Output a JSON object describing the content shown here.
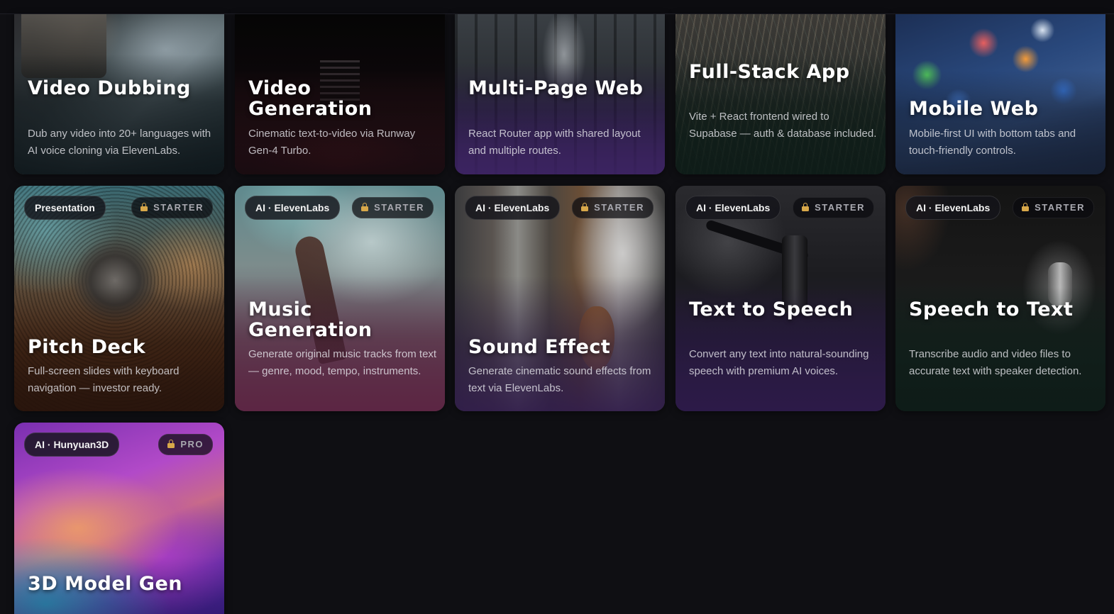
{
  "cards": [
    {
      "title": "Video Dubbing",
      "desc": "Dub any video into 20+ languages with AI voice cloning via ElevenLabs."
    },
    {
      "title": "Video Generation",
      "desc": "Cinematic text-to-video via Runway Gen-4 Turbo."
    },
    {
      "title": "Multi-Page Web",
      "desc": "React Router app with shared layout and multiple routes."
    },
    {
      "title": "Full-Stack App",
      "desc": "Vite + React frontend wired to Supabase — auth & database included."
    },
    {
      "title": "Mobile Web",
      "desc": "Mobile-first UI with bottom tabs and touch-friendly controls."
    },
    {
      "tag": "Presentation",
      "badge": "STARTER",
      "title": "Pitch Deck",
      "desc": "Full-screen slides with keyboard navigation — investor ready."
    },
    {
      "tag": "AI · ElevenLabs",
      "badge": "STARTER",
      "title": "Music Generation",
      "desc": "Generate original music tracks from text — genre, mood, tempo, instruments."
    },
    {
      "tag": "AI · ElevenLabs",
      "badge": "STARTER",
      "title": "Sound Effect",
      "desc": "Generate cinematic sound effects from text via ElevenLabs."
    },
    {
      "tag": "AI · ElevenLabs",
      "badge": "STARTER",
      "title": "Text to Speech",
      "desc": "Convert any text into natural-sounding speech with premium AI voices."
    },
    {
      "tag": "AI · ElevenLabs",
      "badge": "STARTER",
      "title": "Speech to Text",
      "desc": "Transcribe audio and video files to accurate text with speaker detection."
    },
    {
      "tag": "AI · Hunyuan3D",
      "badge": "PRO",
      "title": "3D Model Gen"
    }
  ],
  "colors": {
    "page_background": "#0f0f13",
    "badge_lock": "#d8a84a"
  }
}
